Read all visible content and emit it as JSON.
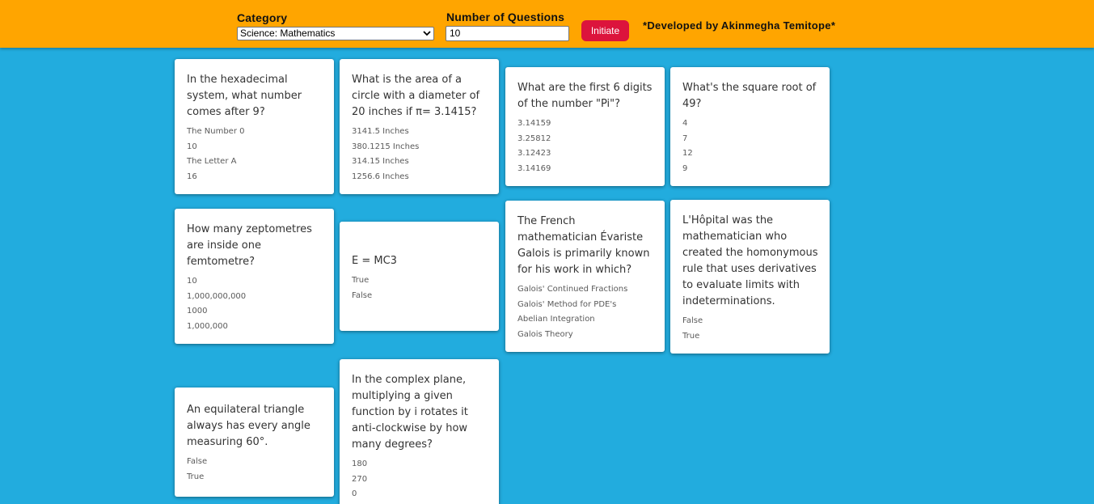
{
  "header": {
    "category_label": "Category",
    "category_value": "Science: Mathematics",
    "count_label": "Number of Questions",
    "count_value": "10",
    "initiate_label": "Initiate",
    "credit": "*Developed by Akinmegha Temitope*"
  },
  "cards": [
    {
      "question": "In the hexadecimal system, what number comes after 9?",
      "options": [
        "The Number 0",
        "10",
        "The Letter A",
        "16"
      ]
    },
    {
      "question": "What is the area of a circle with a diameter of 20 inches if π= 3.1415?",
      "options": [
        "3141.5 Inches",
        "380.1215 Inches",
        "314.15 Inches",
        "1256.6 Inches"
      ]
    },
    {
      "question": "What are the first 6 digits of the number \"Pi\"?",
      "options": [
        "3.14159",
        "3.25812",
        "3.12423",
        "3.14169"
      ]
    },
    {
      "question": "What's the square root of 49?",
      "options": [
        "4",
        "7",
        "12",
        "9"
      ]
    },
    {
      "question": "How many zeptometres are inside one femtometre?",
      "options": [
        "10",
        "1,000,000,000",
        "1000",
        "1,000,000"
      ]
    },
    {
      "question": "E = MC3",
      "options": [
        "True",
        "False"
      ]
    },
    {
      "question": "The French mathematician Évariste Galois is primarily known for his work in which?",
      "options": [
        "Galois' Continued Fractions",
        "Galois' Method for PDE's",
        "Abelian Integration",
        "Galois Theory"
      ]
    },
    {
      "question": "L'Hôpital was the mathematician who created the homonymous rule that uses derivatives to evaluate limits with indeterminations.",
      "options": [
        "False",
        "True"
      ]
    },
    {
      "question": "An equilateral triangle always has every angle measuring 60°.",
      "options": [
        "False",
        "True"
      ]
    },
    {
      "question": "In the complex plane, multiplying a given function by i rotates it anti-clockwise by how many degrees?",
      "options": [
        "180",
        "270",
        "0"
      ]
    }
  ]
}
